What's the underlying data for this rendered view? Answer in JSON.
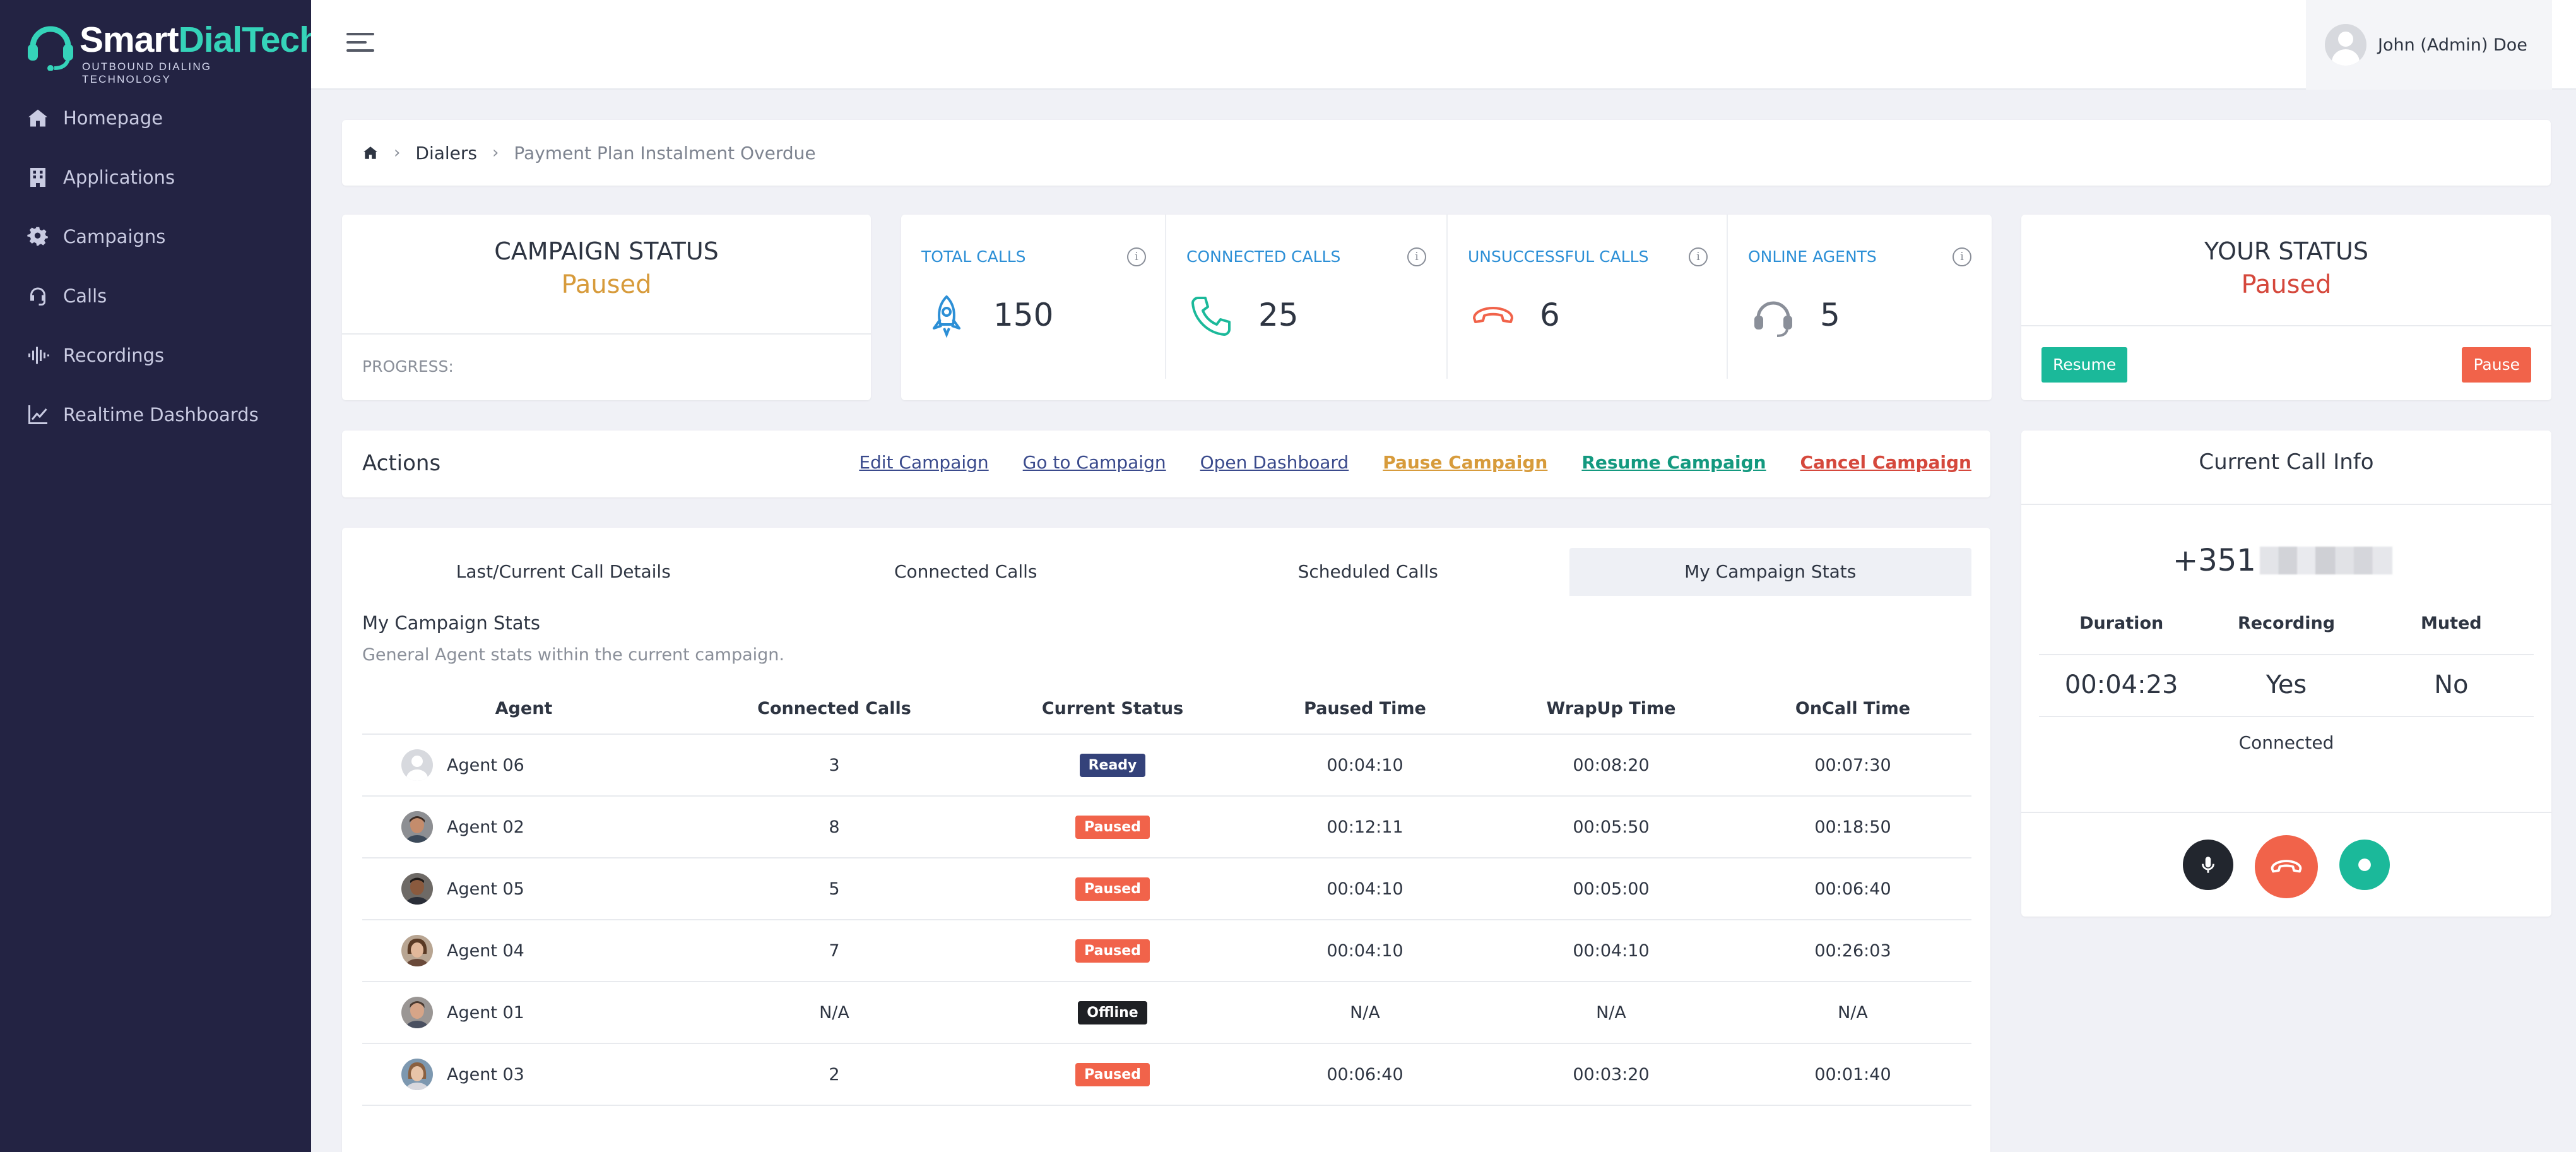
{
  "brand": {
    "name_part1": "Smart",
    "name_part2": "DialTech",
    "tagline": "OUTBOUND DIALING TECHNOLOGY",
    "accent_color": "#35d3b9"
  },
  "sidebar": {
    "items": [
      {
        "label": "Homepage",
        "icon": "home-icon"
      },
      {
        "label": "Applications",
        "icon": "building-icon"
      },
      {
        "label": "Campaigns",
        "icon": "gear-icon"
      },
      {
        "label": "Calls",
        "icon": "headset-icon"
      },
      {
        "label": "Recordings",
        "icon": "audio-wave-icon"
      },
      {
        "label": "Realtime Dashboards",
        "icon": "chart-line-icon"
      }
    ]
  },
  "header": {
    "user_name": "John (Admin) Doe"
  },
  "breadcrumb": {
    "items": [
      "Dialers",
      "Payment Plan Instalment Overdue"
    ]
  },
  "campaign_status": {
    "title": "CAMPAIGN STATUS",
    "value": "Paused",
    "progress_label": "PROGRESS:"
  },
  "stats": [
    {
      "label": "TOTAL CALLS",
      "value": "150",
      "color": "#2c8fd6",
      "icon": "rocket-icon"
    },
    {
      "label": "CONNECTED CALLS",
      "value": "25",
      "color": "#2c8fd6",
      "icon": "phone-icon"
    },
    {
      "label": "UNSUCCESSFUL CALLS",
      "value": "6",
      "color": "#2c8fd6",
      "icon": "hangup-icon"
    },
    {
      "label": "ONLINE AGENTS",
      "value": "5",
      "color": "#2c8fd6",
      "icon": "headset-icon"
    }
  ],
  "your_status": {
    "title": "YOUR STATUS",
    "value": "Paused",
    "resume_label": "Resume",
    "pause_label": "Pause"
  },
  "actions": {
    "title": "Actions",
    "links": [
      {
        "label": "Edit Campaign",
        "color": "#3a4a8c"
      },
      {
        "label": "Go to Campaign",
        "color": "#3a4a8c"
      },
      {
        "label": "Open Dashboard",
        "color": "#3a4a8c"
      },
      {
        "label": "Pause Campaign",
        "color": "#d79b3b"
      },
      {
        "label": "Resume Campaign",
        "color": "#13997f"
      },
      {
        "label": "Cancel Campaign",
        "color": "#d5483c"
      }
    ]
  },
  "tabs": [
    {
      "label": "Last/Current Call Details",
      "active": false
    },
    {
      "label": "Connected Calls",
      "active": false
    },
    {
      "label": "Scheduled Calls",
      "active": false
    },
    {
      "label": "My Campaign Stats",
      "active": true
    }
  ],
  "stats_section": {
    "title": "My Campaign Stats",
    "subtitle": "General Agent stats within the current campaign."
  },
  "table": {
    "headers": [
      "Agent",
      "Connected Calls",
      "Current Status",
      "Paused Time",
      "WrapUp Time",
      "OnCall Time"
    ],
    "rows": [
      {
        "agent": "Agent 06",
        "connected": "3",
        "status": "Ready",
        "status_color": "#34427a",
        "paused": "00:04:10",
        "wrapup": "00:08:20",
        "oncall": "00:07:30",
        "avatar": "placeholder"
      },
      {
        "agent": "Agent 02",
        "connected": "8",
        "status": "Paused",
        "status_color": "#f1634a",
        "paused": "00:12:11",
        "wrapup": "00:05:50",
        "oncall": "00:18:50",
        "avatar": "photo"
      },
      {
        "agent": "Agent 05",
        "connected": "5",
        "status": "Paused",
        "status_color": "#f1634a",
        "paused": "00:04:10",
        "wrapup": "00:05:00",
        "oncall": "00:06:40",
        "avatar": "photo"
      },
      {
        "agent": "Agent 04",
        "connected": "7",
        "status": "Paused",
        "status_color": "#f1634a",
        "paused": "00:04:10",
        "wrapup": "00:04:10",
        "oncall": "00:26:03",
        "avatar": "photo"
      },
      {
        "agent": "Agent 01",
        "connected": "N/A",
        "status": "Offline",
        "status_color": "#1e2024",
        "paused": "N/A",
        "wrapup": "N/A",
        "oncall": "N/A",
        "avatar": "photo"
      },
      {
        "agent": "Agent 03",
        "connected": "2",
        "status": "Paused",
        "status_color": "#f1634a",
        "paused": "00:06:40",
        "wrapup": "00:03:20",
        "oncall": "00:01:40",
        "avatar": "photo"
      }
    ]
  },
  "call_info": {
    "title": "Current Call Info",
    "phone_prefix": "+351",
    "headers": [
      "Duration",
      "Recording",
      "Muted"
    ],
    "values": [
      "00:04:23",
      "Yes",
      "No"
    ],
    "state": "Connected"
  }
}
